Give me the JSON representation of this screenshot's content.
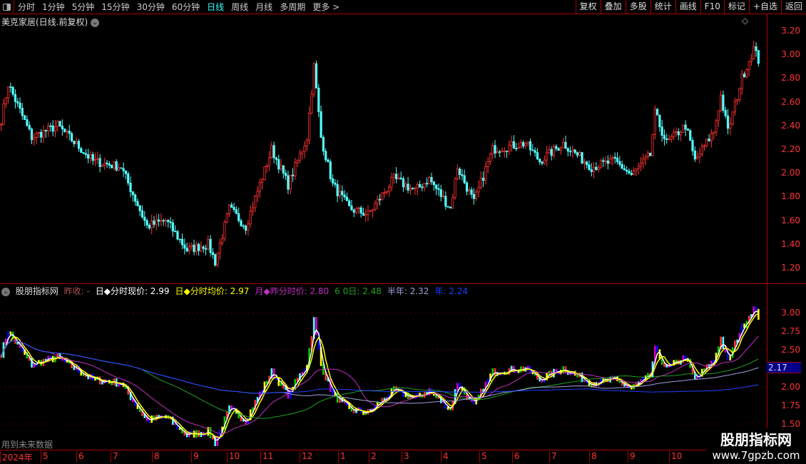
{
  "toolbar": {
    "periods": [
      "分时",
      "1分钟",
      "5分钟",
      "15分钟",
      "30分钟",
      "60分钟",
      "日线",
      "周线",
      "月线",
      "多周期",
      "更多 >"
    ],
    "active": "日线",
    "buttons": [
      "复权",
      "叠加",
      "多股",
      "统计",
      "画线",
      "F10",
      "标记",
      "+自选",
      "返回"
    ]
  },
  "main": {
    "title": "美克家居(日线.前复权)",
    "price_ticks": [
      "3.20",
      "3.00",
      "2.80",
      "2.60",
      "2.40",
      "2.20",
      "2.00",
      "1.80",
      "1.60",
      "1.40",
      "1.20"
    ]
  },
  "indicator": {
    "name": "股朋指标网",
    "prev": "昨收: -",
    "items": [
      {
        "label": "◆分时现价: 2.99",
        "prefix": "日",
        "color": "#ffffff"
      },
      {
        "label": "◆分时均价: 2.97",
        "prefix": "日",
        "color": "#ffff00"
      },
      {
        "label": "月◆昨分时价: 2.80",
        "color": "#c030c0"
      },
      {
        "label": "6 0日: 2.48",
        "color": "#20a020"
      },
      {
        "label": "半年: 2.32",
        "color": "#a0a0e0"
      },
      {
        "label": "年: 2.24",
        "color": "#2040ff"
      }
    ],
    "ticks": [
      "3.00",
      "2.75",
      "2.50",
      "2.00",
      "1.75",
      "1.50"
    ],
    "current": "2.17",
    "note": "用到未来数据"
  },
  "timeline": [
    "2024年",
    "5",
    "6",
    "7",
    "8",
    "9",
    "10",
    "11",
    "12",
    "1",
    "2",
    "3",
    "4",
    "5",
    "6",
    "7",
    "8",
    "9",
    "10"
  ],
  "watermark": {
    "name": "股朋指标网",
    "url": "www.7gpzb.com"
  },
  "chart_data": {
    "type": "candlestick",
    "ylim_main": [
      1.2,
      3.2
    ],
    "ylim_indicator": [
      1.5,
      3.1
    ],
    "keypoints": [
      [
        0,
        2.45
      ],
      [
        3,
        2.75
      ],
      [
        13,
        2.3
      ],
      [
        24,
        2.4
      ],
      [
        39,
        2.1
      ],
      [
        51,
        2.05
      ],
      [
        62,
        1.55
      ],
      [
        70,
        1.6
      ],
      [
        79,
        1.35
      ],
      [
        88,
        1.4
      ],
      [
        91,
        1.25
      ],
      [
        97,
        1.7
      ],
      [
        104,
        1.55
      ],
      [
        115,
        2.2
      ],
      [
        122,
        1.9
      ],
      [
        130,
        2.3
      ],
      [
        133,
        2.9
      ],
      [
        136,
        2.3
      ],
      [
        141,
        1.9
      ],
      [
        148,
        1.7
      ],
      [
        156,
        1.65
      ],
      [
        167,
        1.95
      ],
      [
        176,
        1.85
      ],
      [
        182,
        1.95
      ],
      [
        191,
        1.7
      ],
      [
        194,
        2.05
      ],
      [
        201,
        1.75
      ],
      [
        209,
        2.2
      ],
      [
        223,
        2.25
      ],
      [
        229,
        2.1
      ],
      [
        239,
        2.25
      ],
      [
        251,
        2.05
      ],
      [
        261,
        2.1
      ],
      [
        268,
        1.98
      ],
      [
        276,
        2.15
      ],
      [
        278,
        2.5
      ],
      [
        283,
        2.25
      ],
      [
        291,
        2.4
      ],
      [
        295,
        2.1
      ],
      [
        303,
        2.35
      ],
      [
        306,
        2.65
      ],
      [
        309,
        2.35
      ],
      [
        315,
        2.8
      ],
      [
        320,
        3.05
      ],
      [
        322,
        2.95
      ]
    ]
  }
}
